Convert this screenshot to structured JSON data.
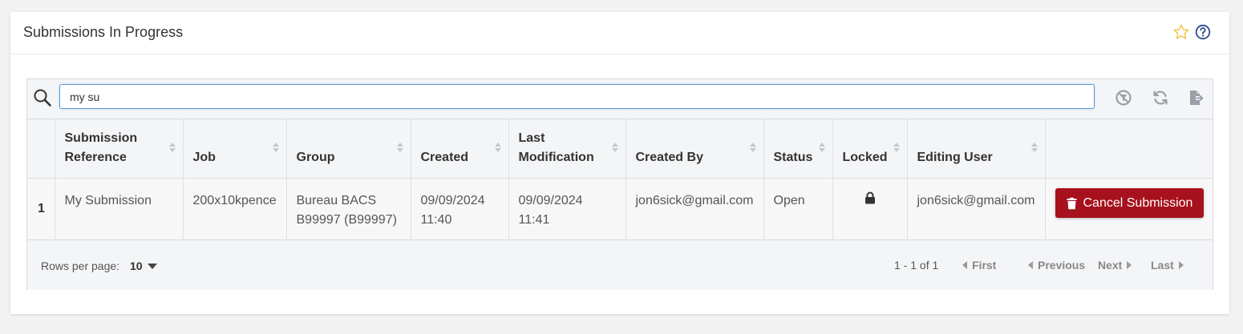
{
  "card": {
    "title": "Submissions In Progress"
  },
  "search": {
    "value": "my su"
  },
  "columns": [
    {
      "label": ""
    },
    {
      "label": "Submission Reference"
    },
    {
      "label": "Job"
    },
    {
      "label": "Group"
    },
    {
      "label": "Created"
    },
    {
      "label": "Last Modification"
    },
    {
      "label": "Created By"
    },
    {
      "label": "Status"
    },
    {
      "label": "Locked"
    },
    {
      "label": "Editing User"
    },
    {
      "label": ""
    }
  ],
  "rows": [
    {
      "num": "1",
      "reference": "My Submission",
      "job": "200x10kpence",
      "group": "Bureau BACS B99997 (B99997)",
      "created": "09/09/2024 11:40",
      "last_modification": "09/09/2024 11:41",
      "created_by": "jon6sick@gmail.com",
      "status": "Open",
      "locked": true,
      "editing_user": "jon6sick@gmail.com",
      "action_label": "Cancel Submission"
    }
  ],
  "footer": {
    "rows_per_page_label": "Rows per page:",
    "rows_per_page_value": "10",
    "range": "1 - 1 of 1",
    "first": "First",
    "previous": "Previous",
    "next": "Next",
    "last": "Last"
  },
  "colors": {
    "danger": "#a7111d",
    "accent": "#5b9bd5",
    "star": "#f0c54a"
  }
}
